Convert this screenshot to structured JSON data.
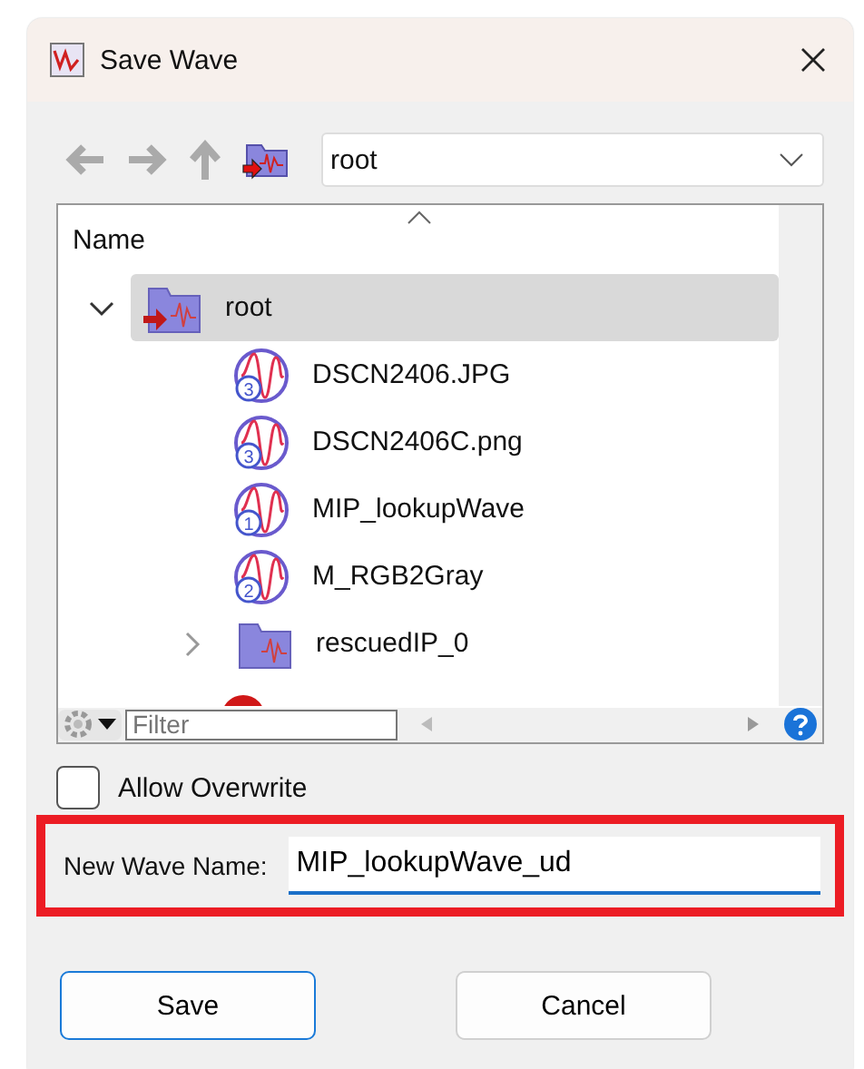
{
  "window": {
    "title": "Save Wave"
  },
  "toolbar": {
    "path": "root"
  },
  "tree": {
    "column": "Name",
    "sorted": true,
    "items": [
      {
        "kind": "folder",
        "current": true,
        "name": "root",
        "expanded": true,
        "selected": true,
        "children": [
          {
            "kind": "wave",
            "name": "DSCN2406.JPG",
            "badge": "3",
            "selected": false
          },
          {
            "kind": "wave",
            "name": "DSCN2406C.png",
            "badge": "3",
            "selected": false
          },
          {
            "kind": "wave",
            "name": "MIP_lookupWave",
            "badge": "1",
            "selected": false
          },
          {
            "kind": "wave",
            "name": "M_RGB2Gray",
            "badge": "2",
            "selected": false
          },
          {
            "kind": "folder",
            "current": false,
            "name": "rescuedIP_0",
            "expanded": false,
            "selected": false
          }
        ]
      }
    ]
  },
  "filter": {
    "placeholder": "Filter"
  },
  "allow_overwrite": {
    "label": "Allow Overwrite",
    "checked": false
  },
  "new_name": {
    "label": "New Wave Name:",
    "value": "MIP_lookupWave_ud",
    "highlighted": true
  },
  "buttons": [
    {
      "label": "Save",
      "default": true
    },
    {
      "label": "Cancel",
      "default": false
    }
  ]
}
